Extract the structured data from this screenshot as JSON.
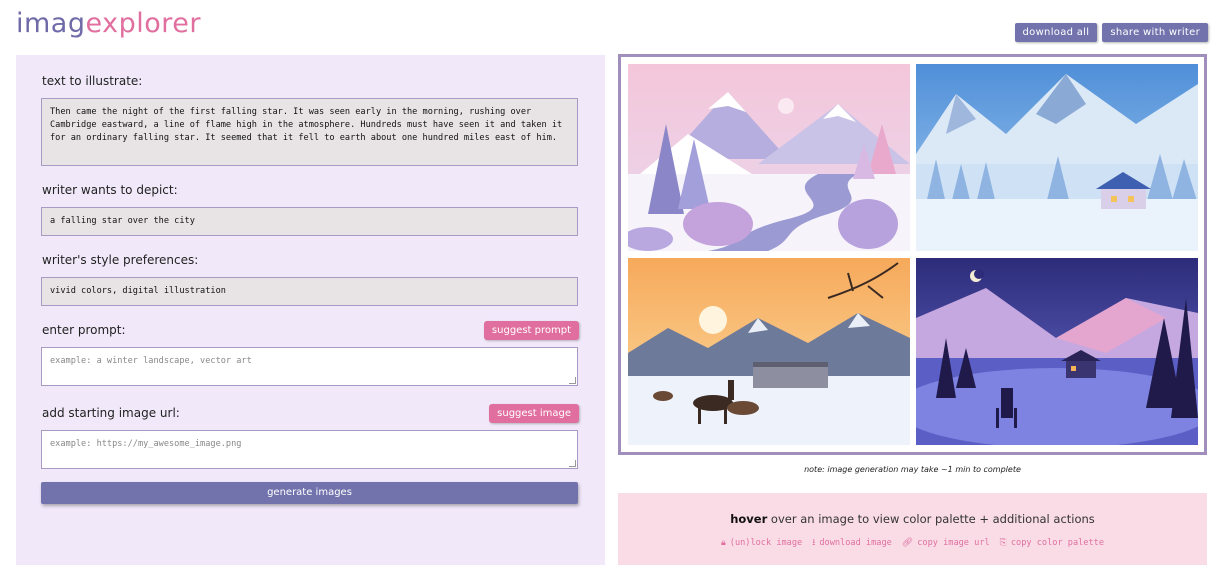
{
  "header": {
    "logo_part1": "imag",
    "logo_part2": "explorer",
    "download_all": "download all",
    "share_with_writer": "share with writer"
  },
  "form": {
    "text_label": "text to illustrate:",
    "text_value": "Then came the night of the first falling star. It was seen early in the morning, rushing over Cambridge eastward, a line of flame high in the atmosphere. Hundreds must have seen it and taken it for an ordinary falling star. It seemed that it fell to earth about one hundred miles east of him.",
    "depict_label": "writer wants to depict:",
    "depict_value": "a falling star over the city",
    "style_label": "writer's style preferences:",
    "style_value": "vivid colors, digital illustration",
    "prompt_label": "enter prompt:",
    "suggest_prompt": "suggest prompt",
    "prompt_placeholder": "example: a winter landscape, vector art",
    "image_label": "add starting image url:",
    "suggest_image": "suggest image",
    "image_placeholder": "example: https://my_awesome_image.png",
    "generate": "generate images"
  },
  "gallery": {
    "note": "note: image generation may take ~1 min to complete",
    "hover_bold": "hover",
    "hover_rest": " over an image to view color palette + additional actions",
    "actions": [
      {
        "icon": "lock-icon",
        "label": "(un)lock image"
      },
      {
        "icon": "download-icon",
        "label": "download image"
      },
      {
        "icon": "link-icon",
        "label": "copy image url"
      },
      {
        "icon": "copy-icon",
        "label": "copy color palette"
      }
    ]
  },
  "colors": {
    "primary": "#7273ad",
    "accent": "#e06f9f",
    "panel": "#f1e9fa",
    "hover_panel": "#fadce7"
  }
}
